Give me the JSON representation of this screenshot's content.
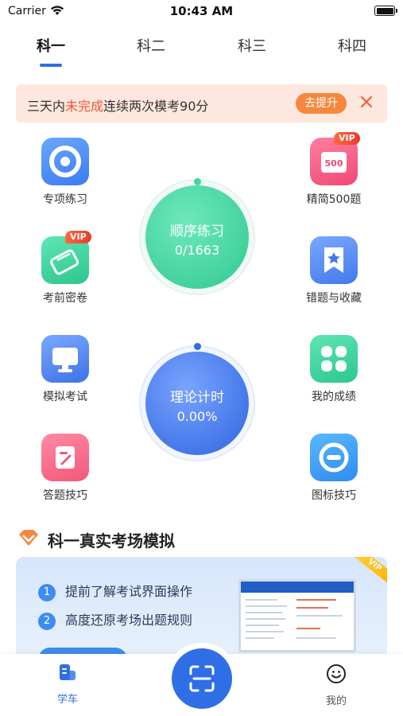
{
  "status_bar": {
    "carrier": "Carrier",
    "time": "10:43 AM"
  },
  "tabs": [
    {
      "label": "科一",
      "active": true
    },
    {
      "label": "科二",
      "active": false
    },
    {
      "label": "科三",
      "active": false
    },
    {
      "label": "科四",
      "active": false
    }
  ],
  "banner": {
    "text_prefix": "三天内",
    "text_highlight": "未完成",
    "text_suffix": "连续两次模考90分",
    "button_label": "去提升"
  },
  "features": {
    "special_practice": {
      "label": "专项练习",
      "icon": "target-icon"
    },
    "exam_secret": {
      "label": "考前密卷",
      "icon": "scroll-icon",
      "badge": "VIP"
    },
    "mock_exam": {
      "label": "模拟考试",
      "icon": "monitor-icon"
    },
    "tips": {
      "label": "答题技巧",
      "icon": "edit-note-icon"
    },
    "selected_500": {
      "label": "精简500题",
      "icon": "book-500-icon",
      "badge": "VIP",
      "icon_text": "500"
    },
    "wrong_favorites": {
      "label": "错题与收藏",
      "icon": "bookmark-star-icon"
    },
    "my_scores": {
      "label": "我的成绩",
      "icon": "grid-icon"
    },
    "sign_tips": {
      "label": "图标技巧",
      "icon": "sign-icon"
    }
  },
  "sequential": {
    "title": "顺序练习",
    "progress": "0/1663"
  },
  "theory_timer": {
    "title": "理论计时",
    "value": "0.00%"
  },
  "section": {
    "title": "科一真实考场模拟",
    "items": [
      "提前了解考试界面操作",
      "高度还原考场出题规则"
    ],
    "numbers": [
      "1",
      "2"
    ],
    "badge": "VIP"
  },
  "tabbar": {
    "learn": {
      "label": "学车"
    },
    "mine": {
      "label": "我的"
    }
  },
  "colors": {
    "primary": "#2f6fe6",
    "highlight": "#f2582c",
    "green_circle": "#3fd6a0",
    "blue_circle": "#3f7cf0"
  }
}
